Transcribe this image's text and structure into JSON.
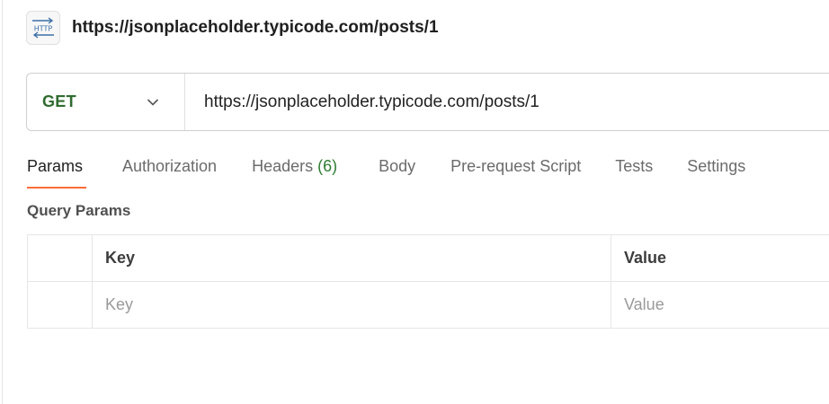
{
  "request": {
    "icon": "http-icon",
    "icon_text": "HTTP",
    "title": "https://jsonplaceholder.typicode.com/posts/1"
  },
  "url_bar": {
    "method": "GET",
    "method_color": "#2f6b2f",
    "url": "https://jsonplaceholder.typicode.com/posts/1"
  },
  "tabs": [
    {
      "label": "Params",
      "active": true
    },
    {
      "label": "Authorization"
    },
    {
      "label": "Headers",
      "count": "(6)"
    },
    {
      "label": "Body"
    },
    {
      "label": "Pre-request Script"
    },
    {
      "label": "Tests"
    },
    {
      "label": "Settings"
    }
  ],
  "query_params": {
    "title": "Query Params",
    "columns": {
      "key": "Key",
      "value": "Value"
    },
    "row": {
      "key_placeholder": "Key",
      "value_placeholder": "Value"
    }
  },
  "colors": {
    "accent": "#ff6c37",
    "count": "#2f7d32"
  }
}
